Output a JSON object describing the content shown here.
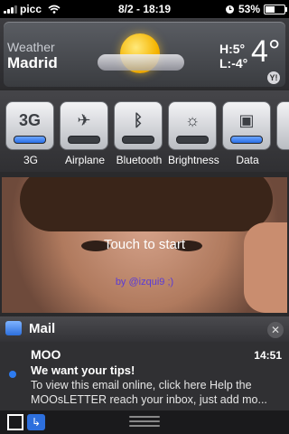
{
  "statusbar": {
    "carrier": "picc",
    "time": "8/2 - 18:19",
    "battery": "53%"
  },
  "weather": {
    "title": "Weather",
    "city": "Madrid",
    "high": "H:5°",
    "low": "L:-4°",
    "temp": "4°",
    "provider_badge": "Y!"
  },
  "toggles": [
    {
      "label": "3G",
      "glyph": "3G",
      "on": true
    },
    {
      "label": "Airplane",
      "glyph": "✈",
      "on": false
    },
    {
      "label": "Bluetooth",
      "glyph": "ᛒ",
      "on": false
    },
    {
      "label": "Brightness",
      "glyph": "☼",
      "on": false
    },
    {
      "label": "Data",
      "glyph": "▣",
      "on": true
    }
  ],
  "video": {
    "touch_text": "Touch to start",
    "credit": "by @izqui9 ;)"
  },
  "mail": {
    "title": "Mail",
    "close": "✕",
    "sender": "MOO",
    "time": "14:51",
    "subject": "We want your tips!",
    "preview": "To view this email online, click here Help the MOOsLETTER reach your inbox, just add mo..."
  },
  "bottom": {
    "reply_glyph": "↳"
  },
  "colors": {
    "accent_blue": "#2d7bf0",
    "sun": "#f5b400"
  }
}
